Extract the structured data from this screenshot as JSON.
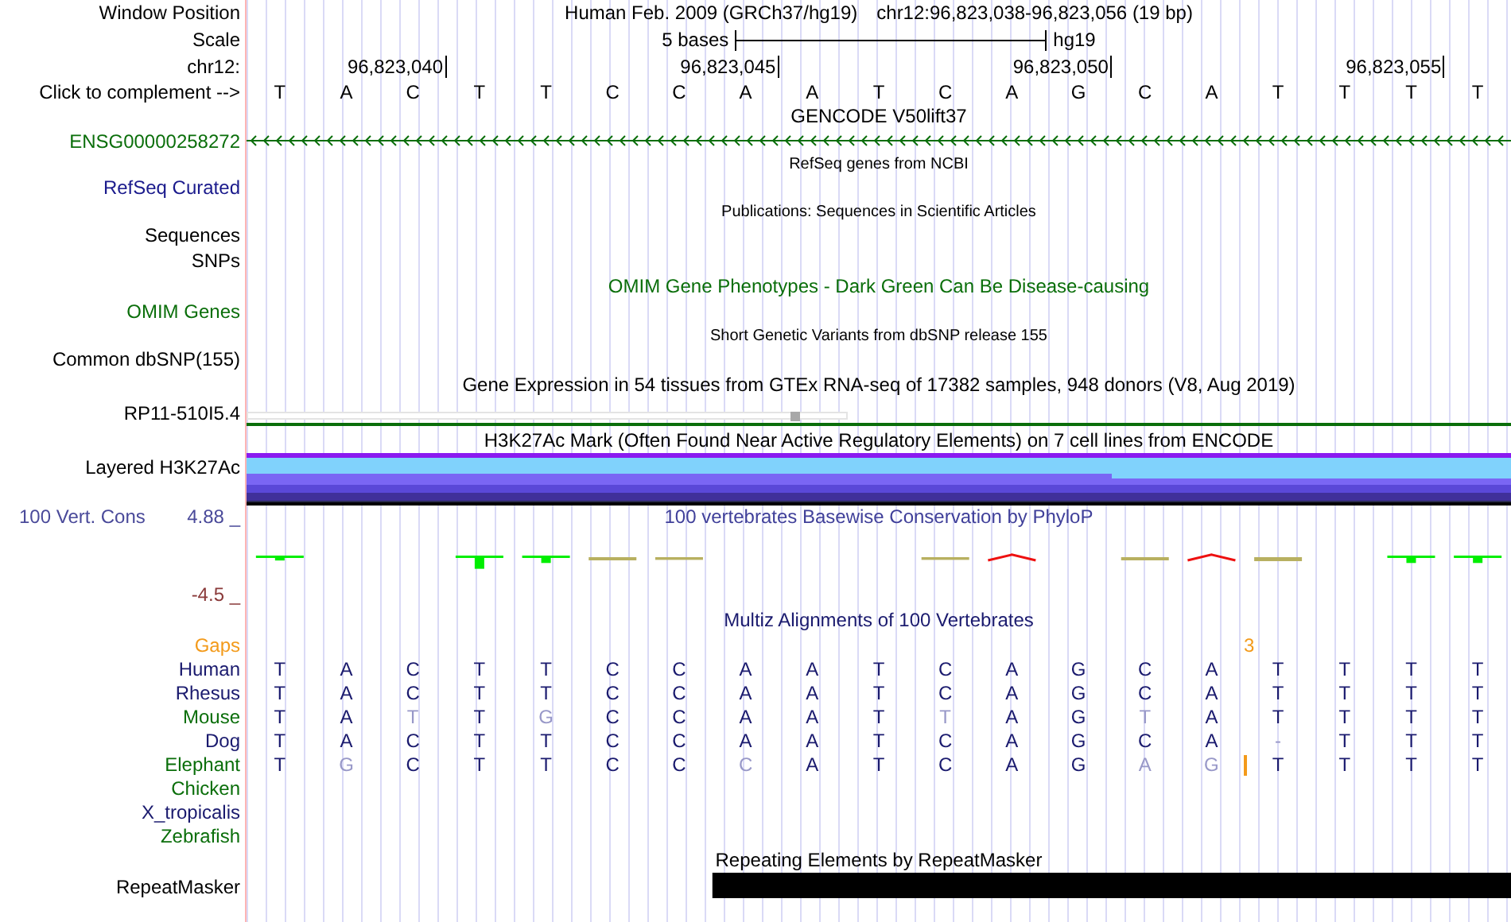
{
  "tracks": [
    {
      "kind": "position",
      "label": "Window Position",
      "assembly": "Human Feb. 2009 (GRCh37/hg19)",
      "range": "chr12:96,823,038-96,823,056 (19 bp)"
    },
    {
      "kind": "scale",
      "label": "Scale",
      "span": "5 bases",
      "assembly": "hg19"
    },
    {
      "kind": "ruler",
      "label": "chr12:",
      "complement_label": "Click to complement -->",
      "columns": [
        {
          "base": "T"
        },
        {
          "base": "A"
        },
        {
          "base": "C",
          "tick": "96,823,040"
        },
        {
          "base": "T"
        },
        {
          "base": "T"
        },
        {
          "base": "C"
        },
        {
          "base": "C"
        },
        {
          "base": "A",
          "tick": "96,823,045"
        },
        {
          "base": "A"
        },
        {
          "base": "T"
        },
        {
          "base": "C"
        },
        {
          "base": "A"
        },
        {
          "base": "G",
          "tick": "96,823,050"
        },
        {
          "base": "C"
        },
        {
          "base": "A"
        },
        {
          "base": "T"
        },
        {
          "base": "T"
        },
        {
          "base": "T",
          "tick": "96,823,055"
        },
        {
          "base": "T"
        }
      ]
    },
    {
      "kind": "title",
      "title": "GENCODE V50lift37",
      "color": "#000000"
    },
    {
      "kind": "gene",
      "label": "ENSG00000258272",
      "color": "#0a6e0a"
    },
    {
      "kind": "note",
      "title": "RefSeq genes from NCBI"
    },
    {
      "kind": "label",
      "label": "RefSeq Curated",
      "color": "#1a1a8c"
    },
    {
      "kind": "note",
      "title": "Publications: Sequences in Scientific Articles"
    },
    {
      "kind": "label",
      "label": "Sequences",
      "color": "#000000"
    },
    {
      "kind": "label",
      "label": "SNPs",
      "color": "#000000"
    },
    {
      "kind": "title",
      "title": "OMIM Gene Phenotypes - Dark Green Can Be Disease-causing",
      "color": "#0a6e0a"
    },
    {
      "kind": "label",
      "label": "OMIM Genes",
      "color": "#0a6e0a"
    },
    {
      "kind": "note",
      "title": "Short Genetic Variants from dbSNP release 155"
    },
    {
      "kind": "label",
      "label": "Common dbSNP(155)",
      "color": "#000000"
    },
    {
      "kind": "title",
      "title": "Gene Expression in 54 tissues from GTEx RNA-seq of 17382 samples, 948 donors (V8, Aug 2019)",
      "color": "#000000"
    },
    {
      "kind": "expression",
      "label": "RP11-510I5.4"
    },
    {
      "kind": "title",
      "title": "H3K27Ac Mark (Often Found Near Active Regulatory Elements) on 7 cell lines from ENCODE",
      "color": "#000000"
    },
    {
      "kind": "layered",
      "label": "Layered H3K27Ac"
    },
    {
      "kind": "wiggle",
      "label": "100 Vert. Cons",
      "title": "100 vertebrates Basewise Conservation by PhyloP",
      "max_label": "4.88 _",
      "min_label": "-4.5 _"
    },
    {
      "kind": "title",
      "title": "Multiz Alignments of 100 Vertebrates",
      "color": "#1a1a6e"
    },
    {
      "kind": "gaps",
      "label": "Gaps"
    },
    {
      "kind": "species",
      "label": "Human",
      "color": "#1a1a6e",
      "bases": [
        {
          "base": "T",
          "differs": false
        },
        {
          "base": "A",
          "differs": false
        },
        {
          "base": "C",
          "differs": false
        },
        {
          "base": "T",
          "differs": false
        },
        {
          "base": "T",
          "differs": false
        },
        {
          "base": "C",
          "differs": false
        },
        {
          "base": "C",
          "differs": false
        },
        {
          "base": "A",
          "differs": false
        },
        {
          "base": "A",
          "differs": false
        },
        {
          "base": "T",
          "differs": false
        },
        {
          "base": "C",
          "differs": false
        },
        {
          "base": "A",
          "differs": false
        },
        {
          "base": "G",
          "differs": false
        },
        {
          "base": "C",
          "differs": false
        },
        {
          "base": "A",
          "differs": false
        },
        {
          "base": "T",
          "differs": false
        },
        {
          "base": "T",
          "differs": false
        },
        {
          "base": "T",
          "differs": false
        },
        {
          "base": "T",
          "differs": false
        }
      ]
    },
    {
      "kind": "species",
      "label": "Rhesus",
      "color": "#1a1a6e",
      "bases": [
        {
          "base": "T",
          "differs": false
        },
        {
          "base": "A",
          "differs": false
        },
        {
          "base": "C",
          "differs": false
        },
        {
          "base": "T",
          "differs": false
        },
        {
          "base": "T",
          "differs": false
        },
        {
          "base": "C",
          "differs": false
        },
        {
          "base": "C",
          "differs": false
        },
        {
          "base": "A",
          "differs": false
        },
        {
          "base": "A",
          "differs": false
        },
        {
          "base": "T",
          "differs": false
        },
        {
          "base": "C",
          "differs": false
        },
        {
          "base": "A",
          "differs": false
        },
        {
          "base": "G",
          "differs": false
        },
        {
          "base": "C",
          "differs": false
        },
        {
          "base": "A",
          "differs": false
        },
        {
          "base": "T",
          "differs": false
        },
        {
          "base": "T",
          "differs": false
        },
        {
          "base": "T",
          "differs": false
        },
        {
          "base": "T",
          "differs": false
        }
      ]
    },
    {
      "kind": "species",
      "label": "Mouse",
      "color": "#0a6e0a",
      "bases": [
        {
          "base": "T",
          "differs": false
        },
        {
          "base": "A",
          "differs": false
        },
        {
          "base": "T",
          "differs": true
        },
        {
          "base": "T",
          "differs": false
        },
        {
          "base": "G",
          "differs": true
        },
        {
          "base": "C",
          "differs": false
        },
        {
          "base": "C",
          "differs": false
        },
        {
          "base": "A",
          "differs": false
        },
        {
          "base": "A",
          "differs": false
        },
        {
          "base": "T",
          "differs": false
        },
        {
          "base": "T",
          "differs": true
        },
        {
          "base": "A",
          "differs": false
        },
        {
          "base": "G",
          "differs": false
        },
        {
          "base": "T",
          "differs": true
        },
        {
          "base": "A",
          "differs": false
        },
        {
          "base": "T",
          "differs": false
        },
        {
          "base": "T",
          "differs": false
        },
        {
          "base": "T",
          "differs": false
        },
        {
          "base": "T",
          "differs": false
        }
      ]
    },
    {
      "kind": "species",
      "label": "Dog",
      "color": "#1a1a6e",
      "bases": [
        {
          "base": "T",
          "differs": false
        },
        {
          "base": "A",
          "differs": false
        },
        {
          "base": "C",
          "differs": false
        },
        {
          "base": "T",
          "differs": false
        },
        {
          "base": "T",
          "differs": false
        },
        {
          "base": "C",
          "differs": false
        },
        {
          "base": "C",
          "differs": false
        },
        {
          "base": "A",
          "differs": false
        },
        {
          "base": "A",
          "differs": false
        },
        {
          "base": "T",
          "differs": false
        },
        {
          "base": "C",
          "differs": false
        },
        {
          "base": "A",
          "differs": false
        },
        {
          "base": "G",
          "differs": false
        },
        {
          "base": "C",
          "differs": false
        },
        {
          "base": "A",
          "differs": false
        },
        {
          "base": "-",
          "differs": true
        },
        {
          "base": "T",
          "differs": false
        },
        {
          "base": "T",
          "differs": false
        },
        {
          "base": "T",
          "differs": false
        }
      ]
    },
    {
      "kind": "species",
      "label": "Elephant",
      "color": "#0a6e0a",
      "bases": [
        {
          "base": "T",
          "differs": false
        },
        {
          "base": "G",
          "differs": true
        },
        {
          "base": "C",
          "differs": false
        },
        {
          "base": "T",
          "differs": false
        },
        {
          "base": "T",
          "differs": false
        },
        {
          "base": "C",
          "differs": false
        },
        {
          "base": "C",
          "differs": false
        },
        {
          "base": "C",
          "differs": true
        },
        {
          "base": "A",
          "differs": false
        },
        {
          "base": "T",
          "differs": false
        },
        {
          "base": "C",
          "differs": false
        },
        {
          "base": "A",
          "differs": false
        },
        {
          "base": "G",
          "differs": false
        },
        {
          "base": "A",
          "differs": true
        },
        {
          "base": "G",
          "differs": true,
          "insertion_after": true,
          "gap_count": "3"
        },
        {
          "base": "T",
          "differs": false
        },
        {
          "base": "T",
          "differs": false
        },
        {
          "base": "T",
          "differs": false
        },
        {
          "base": "T",
          "differs": false
        }
      ]
    },
    {
      "kind": "species",
      "label": "Chicken",
      "color": "#0a6e0a"
    },
    {
      "kind": "species",
      "label": "X_tropicalis",
      "color": "#1a1a6e"
    },
    {
      "kind": "species",
      "label": "Zebrafish",
      "color": "#0a6e0a"
    },
    {
      "kind": "title",
      "title": "Repeating Elements by RepeatMasker",
      "color": "#000000"
    },
    {
      "kind": "repeat",
      "label": "RepeatMasker",
      "covered": [
        false,
        false,
        false,
        false,
        false,
        false,
        false,
        true,
        true,
        true,
        true,
        true,
        true,
        true,
        true,
        true,
        true,
        true,
        true
      ]
    }
  ]
}
